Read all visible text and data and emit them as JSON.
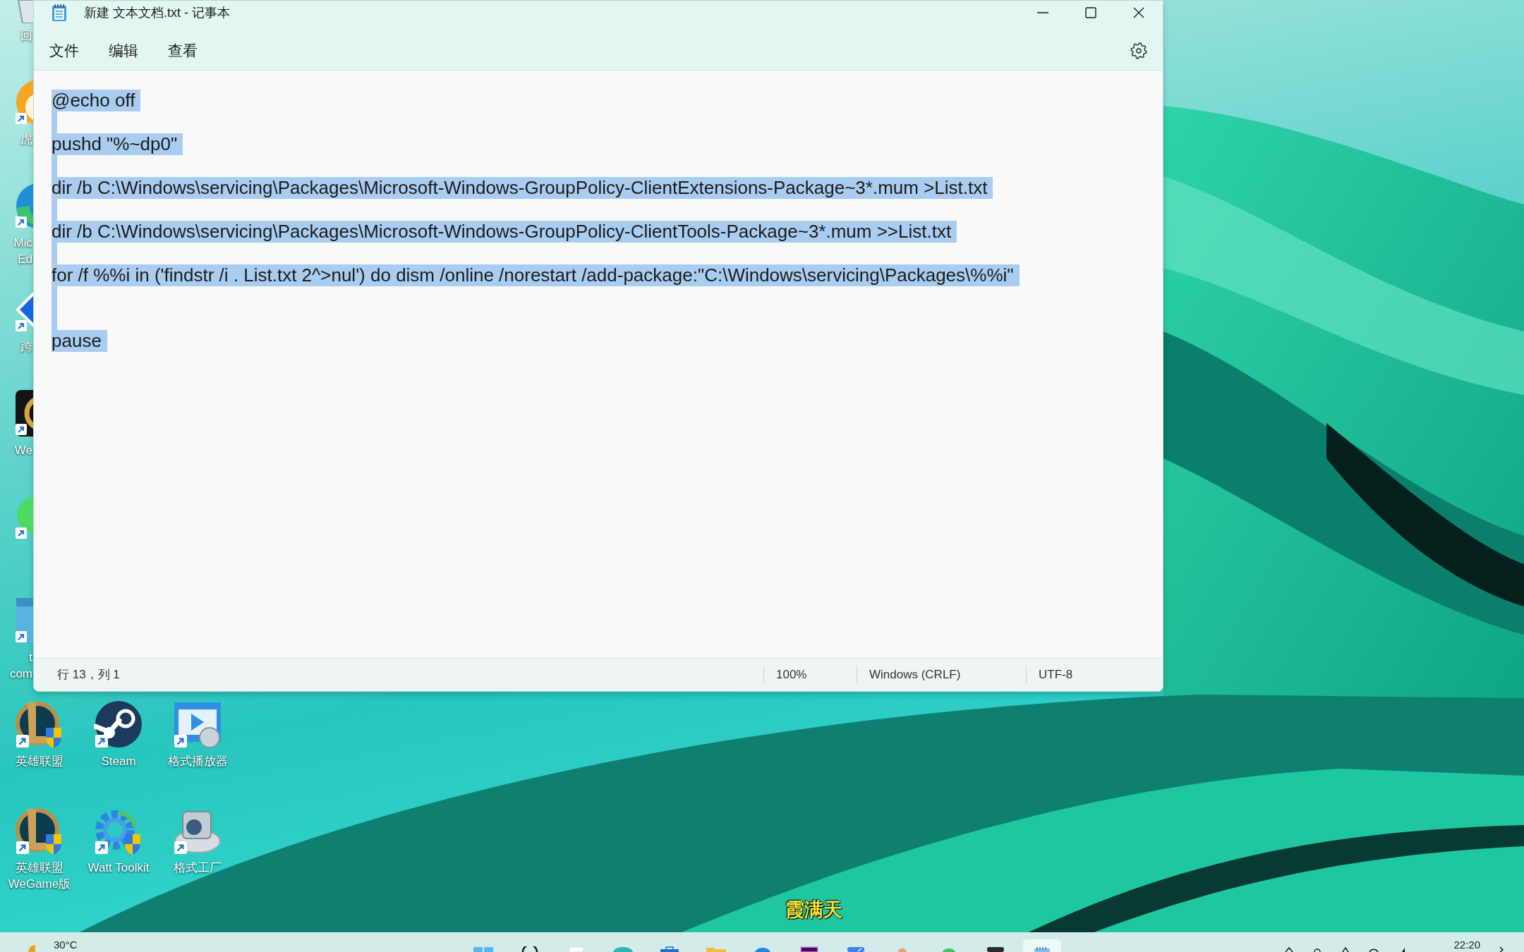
{
  "desktop": {
    "left_column": [
      {
        "label_lines": [
          "回"
        ]
      },
      {
        "label_lines": [
          "虎"
        ],
        "shortcut": true
      },
      {
        "label_lines": [
          "Mic",
          "Ed"
        ],
        "shortcut": true
      },
      {
        "label_lines": [
          "跨"
        ],
        "shortcut": true
      },
      {
        "label_lines": [
          "We"
        ],
        "shortcut": true
      },
      {
        "shortcut": true
      },
      {
        "label_lines": [
          "t",
          "com"
        ],
        "shortcut": true
      }
    ],
    "icons": [
      {
        "label": "英雄联盟",
        "shortcut": true
      },
      {
        "label": "Steam",
        "shortcut": true
      },
      {
        "label": "格式播放器",
        "shortcut": true
      },
      {
        "label": "英雄联盟WeGame版",
        "shortcut": true
      },
      {
        "label": "Watt Toolkit",
        "shortcut": true
      },
      {
        "label": "格式工厂",
        "shortcut": true
      }
    ],
    "subtitle": "霞满天"
  },
  "window": {
    "title": "新建 文本文档.txt - 记事本",
    "menu": [
      {
        "label": "文件"
      },
      {
        "label": "编辑"
      },
      {
        "label": "查看"
      }
    ],
    "editor": {
      "lines": [
        {
          "kind": "text",
          "text": "@echo off",
          "selected": true
        },
        {
          "kind": "blank",
          "selected": true
        },
        {
          "kind": "text",
          "text": "pushd \"%~dp0\"",
          "selected": true
        },
        {
          "kind": "blank",
          "selected": true
        },
        {
          "kind": "text",
          "text": "dir /b C:\\Windows\\servicing\\Packages\\Microsoft-Windows-GroupPolicy-ClientExtensions-Package~3*.mum >List.txt",
          "selected": true
        },
        {
          "kind": "blank",
          "selected": true
        },
        {
          "kind": "text",
          "text": "dir /b C:\\Windows\\servicing\\Packages\\Microsoft-Windows-GroupPolicy-ClientTools-Package~3*.mum >>List.txt",
          "selected": true
        },
        {
          "kind": "blank",
          "selected": true
        },
        {
          "kind": "text",
          "text": "for /f %%i in ('findstr /i . List.txt 2^>nul') do dism /online /norestart /add-package:\"C:\\Windows\\servicing\\Packages\\%%i\"",
          "selected": true
        },
        {
          "kind": "blank",
          "selected": true
        },
        {
          "kind": "blank",
          "selected": true
        },
        {
          "kind": "text",
          "text": "pause",
          "selected": true
        }
      ]
    },
    "status_bar": {
      "cursor": "行 13，列 1",
      "zoom": "100%",
      "line_ending": "Windows (CRLF)",
      "encoding": "UTF-8"
    }
  },
  "taskbar": {
    "weather": "30°C",
    "apps": [
      {
        "active": false
      },
      {
        "active": false
      },
      {
        "active": false
      },
      {
        "active": false
      },
      {
        "active": false
      },
      {
        "active": false
      },
      {
        "active": false
      },
      {
        "active": false
      },
      {
        "active": false
      },
      {
        "active": false
      },
      {
        "active": false
      },
      {
        "active": false
      },
      {
        "active": true
      }
    ],
    "clock": "22:20"
  }
}
